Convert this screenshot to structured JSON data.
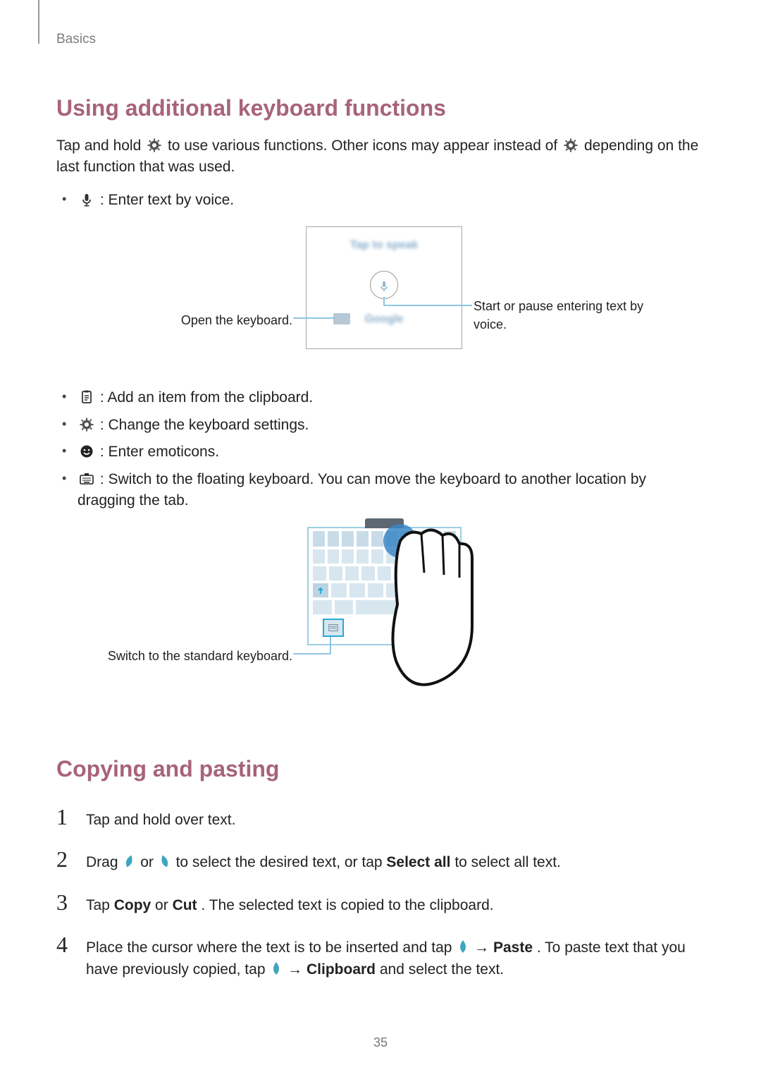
{
  "breadcrumb": "Basics",
  "section1_title": "Using additional keyboard functions",
  "intro_a": "Tap and hold ",
  "intro_b": " to use various functions. Other icons may appear instead of ",
  "intro_c": " depending on the last function that was used.",
  "bullet_voice": " : Enter text by voice.",
  "voice_blur_top": "Tap to speak",
  "voice_blur_brand": "Google",
  "label_open_kb": "Open the keyboard.",
  "label_start_voice": "Start or pause entering text by voice.",
  "bullet_clipboard": " : Add an item from the clipboard.",
  "bullet_settings": " : Change the keyboard settings.",
  "bullet_emoticons": " : Enter emoticons.",
  "bullet_floating": " : Switch to the floating keyboard. You can move the keyboard to another location by dragging the tab.",
  "label_switch_std": "Switch to the standard keyboard.",
  "section2_title": "Copying and pasting",
  "step1": "Tap and hold over text.",
  "step2_a": "Drag ",
  "step2_b": " or ",
  "step2_c": " to select the desired text, or tap ",
  "step2_selectall": "Select all",
  "step2_d": " to select all text.",
  "step3_a": "Tap ",
  "step3_copy": "Copy",
  "step3_b": " or ",
  "step3_cut": "Cut",
  "step3_c": ". The selected text is copied to the clipboard.",
  "step4_a": "Place the cursor where the text is to be inserted and tap ",
  "step4_b": " → ",
  "step4_paste": "Paste",
  "step4_c": ". To paste text that you have previously copied, tap ",
  "step4_d": " → ",
  "step4_clipboard": "Clipboard",
  "step4_e": " and select the text.",
  "page_number": "35"
}
